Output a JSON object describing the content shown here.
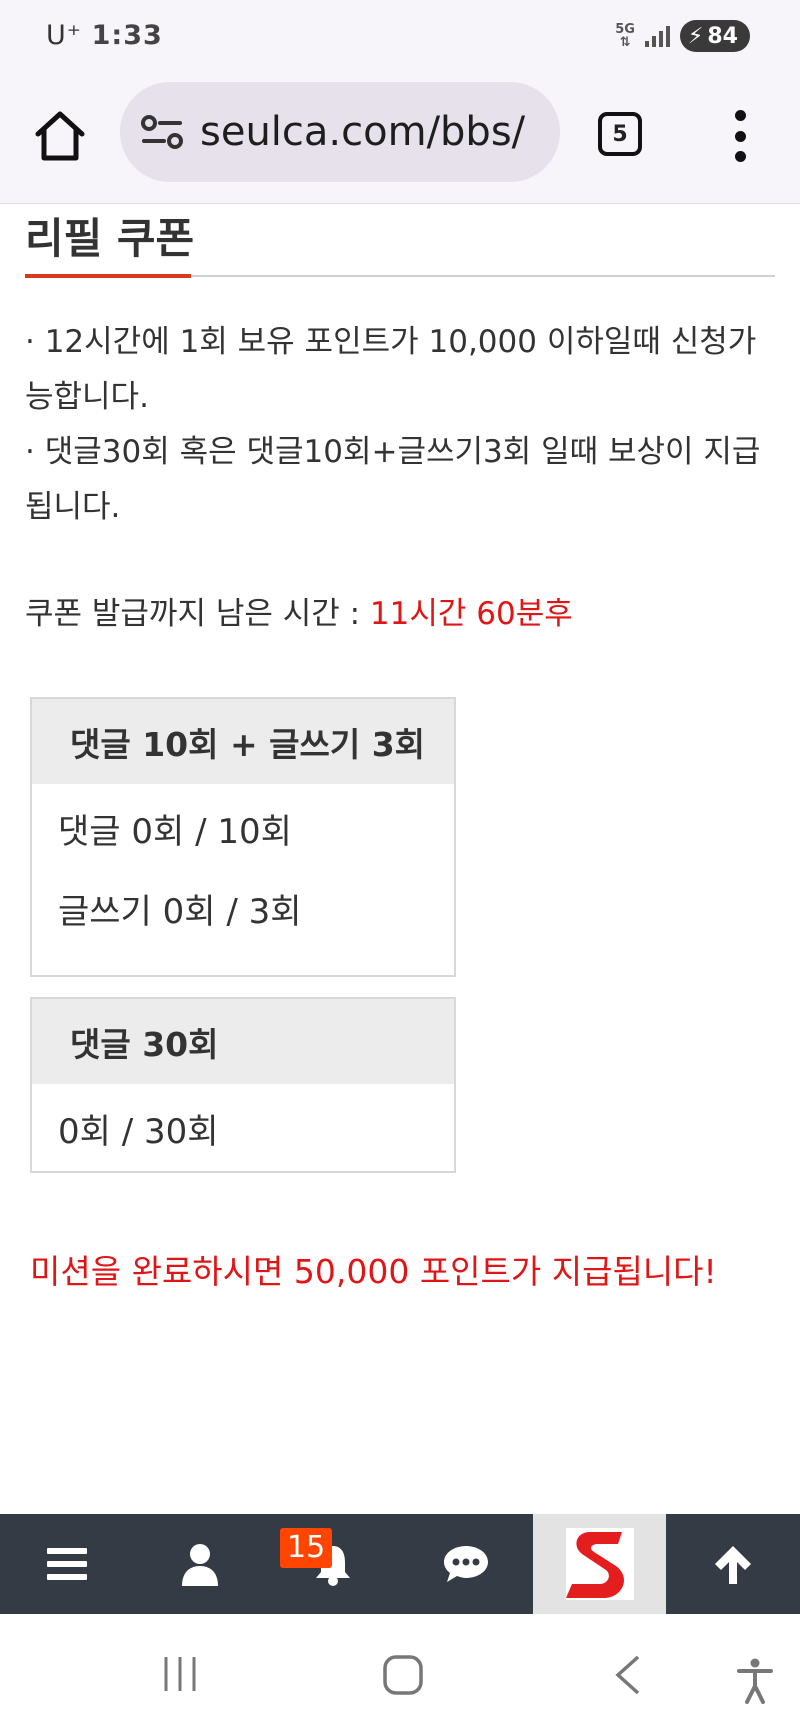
{
  "status_bar": {
    "carrier": "U⁺",
    "time": "1:33",
    "network": "5G",
    "battery": "84"
  },
  "browser": {
    "url": "seulca.com/bbs/",
    "tab_count": "5"
  },
  "page": {
    "title": "리필 쿠폰",
    "desc_line1": "· 12시간에 1회 보유 포인트가 10,000 이하일때 신청가능합니다.",
    "desc_line2": "· 댓글30회 혹은 댓글10회+글쓰기3회 일때 보상이 지급됩니다.",
    "timer_label": "쿠폰 발급까지 남은 시간 : ",
    "timer_value": "11시간 60분후",
    "mission1": {
      "title": "댓글 10회 + 글쓰기 3회",
      "line1": "댓글 0회 / 10회",
      "line2": "글쓰기 0회 / 3회"
    },
    "mission2": {
      "title": "댓글 30회",
      "line1": "0회 / 30회"
    },
    "reward": "미션을 완료하시면 50,000 포인트가 지급됩니다!"
  },
  "app_nav": {
    "items": [
      "menu-icon",
      "user-icon",
      "bell-icon",
      "chat-icon",
      "site-logo",
      "arrow-up-icon"
    ],
    "notification_count": "15",
    "logo_letter": "S"
  },
  "colors": {
    "accent_red": "#e01515",
    "title_underline": "#d63b1d",
    "nav_bg": "#353b45",
    "badge_bg": "#ff4500"
  }
}
